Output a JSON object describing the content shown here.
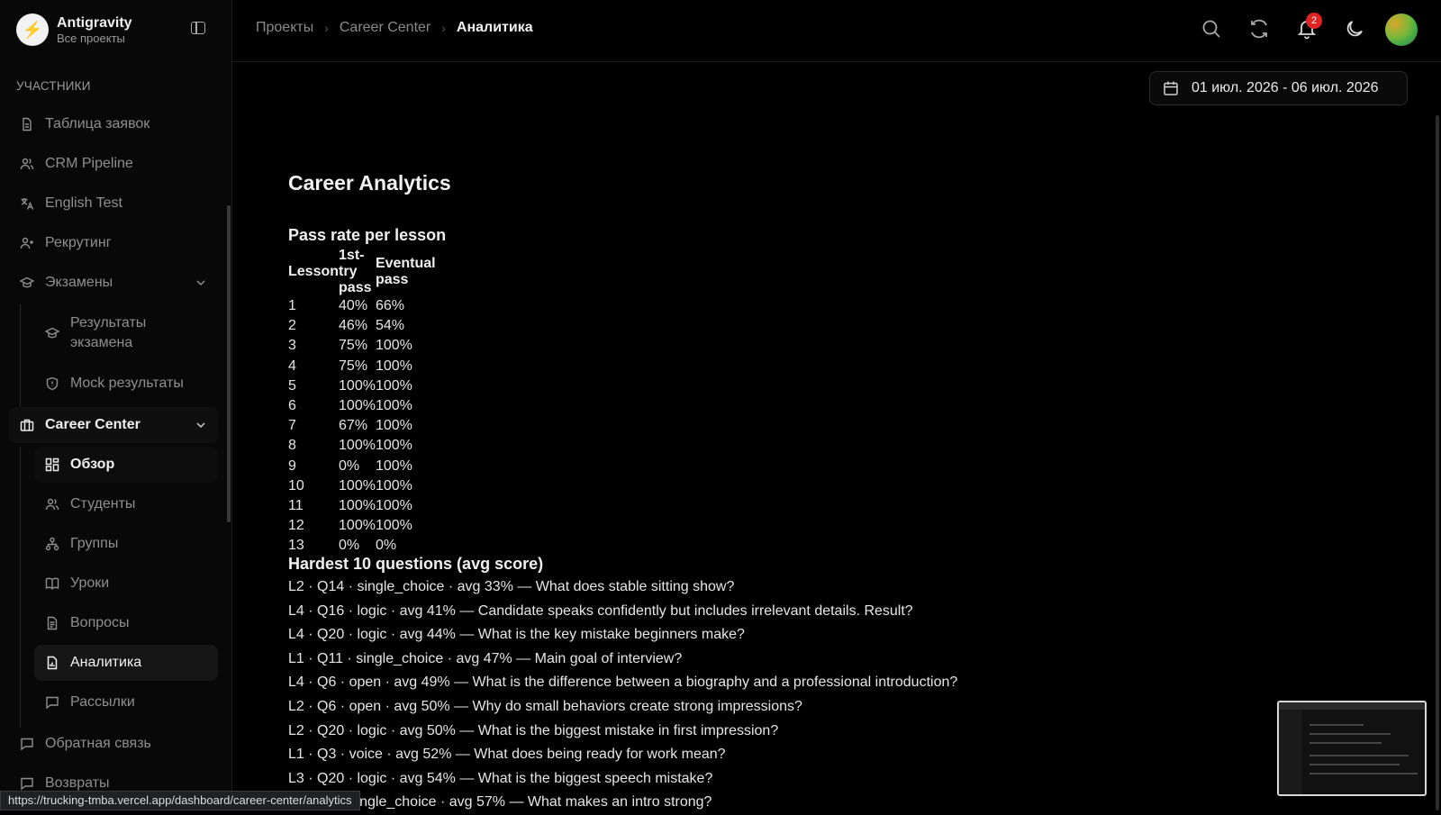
{
  "brand": {
    "name": "Antigravity",
    "subtitle": "Все проекты",
    "logo_icon": "bolt-icon"
  },
  "sidebar": {
    "section_title": "УЧАСТНИКИ",
    "items": [
      {
        "label": "Таблица заявок",
        "icon": "document-icon"
      },
      {
        "label": "CRM Pipeline",
        "icon": "users-icon"
      },
      {
        "label": "English Test",
        "icon": "translate-icon"
      },
      {
        "label": "Рекрутинг",
        "icon": "user-plus-icon"
      },
      {
        "label": "Экзамены",
        "icon": "graduation-cap-icon",
        "expanded": true
      },
      {
        "label": "Результаты экзамена",
        "icon": "graduation-cap-icon"
      },
      {
        "label": "Mock результаты",
        "icon": "shield-icon"
      },
      {
        "label": "Career Center",
        "icon": "briefcase-icon",
        "expanded": true
      },
      {
        "label": "Обзор",
        "icon": "grid-icon"
      },
      {
        "label": "Студенты",
        "icon": "users-icon"
      },
      {
        "label": "Группы",
        "icon": "hierarchy-icon"
      },
      {
        "label": "Уроки",
        "icon": "book-icon"
      },
      {
        "label": "Вопросы",
        "icon": "file-text-icon"
      },
      {
        "label": "Аналитика",
        "icon": "file-chart-icon",
        "active": true
      },
      {
        "label": "Рассылки",
        "icon": "message-icon"
      },
      {
        "label": "Обратная связь",
        "icon": "message-icon"
      },
      {
        "label": "Возвраты",
        "icon": "message-icon"
      }
    ]
  },
  "header": {
    "breadcrumb": [
      "Проекты",
      "Career Center",
      "Аналитика"
    ],
    "notification_count": "2",
    "icons": [
      "search-icon",
      "refresh-icon",
      "bell-icon",
      "moon-icon"
    ]
  },
  "date_range": "01 июл. 2026 - 06 июл. 2026",
  "content": {
    "title": "Career Analytics",
    "pass_rate": {
      "heading": "Pass rate per lesson",
      "columns": [
        "Lesson",
        "1st-try pass",
        "Eventual pass"
      ],
      "rows": [
        [
          "1",
          "40%",
          "66%"
        ],
        [
          "2",
          "46%",
          "54%"
        ],
        [
          "3",
          "75%",
          "100%"
        ],
        [
          "4",
          "75%",
          "100%"
        ],
        [
          "5",
          "100%",
          "100%"
        ],
        [
          "6",
          "100%",
          "100%"
        ],
        [
          "7",
          "67%",
          "100%"
        ],
        [
          "8",
          "100%",
          "100%"
        ],
        [
          "9",
          "0%",
          "100%"
        ],
        [
          "10",
          "100%",
          "100%"
        ],
        [
          "11",
          "100%",
          "100%"
        ],
        [
          "12",
          "100%",
          "100%"
        ],
        [
          "13",
          "0%",
          "0%"
        ]
      ]
    },
    "hardest": {
      "heading": "Hardest 10 questions (avg score)",
      "items": [
        "L2 · Q14 · single_choice · avg 33% — What does stable sitting show?",
        "L4 · Q16 · logic · avg 41% — Candidate speaks confidently but includes irrelevant details. Result?",
        "L4 · Q20 · logic · avg 44% — What is the key mistake beginners make?",
        "L1 · Q11 · single_choice · avg 47% — Main goal of interview?",
        "L4 · Q6 · open · avg 49% — What is the difference between a biography and a professional introduction?",
        "L2 · Q6 · open · avg 50% — Why do small behaviors create strong impressions?",
        "L2 · Q20 · logic · avg 50% — What is the biggest mistake in first impression?",
        "L1 · Q3 · voice · avg 52% — What does being ready for work mean?",
        "L3 · Q20 · logic · avg 54% — What is the biggest speech mistake?",
        "L3 · Q? · single_choice · avg 57% — What makes an intro strong?"
      ]
    }
  },
  "status_url": "https://trucking-tmba.vercel.app/dashboard/career-center/analytics"
}
